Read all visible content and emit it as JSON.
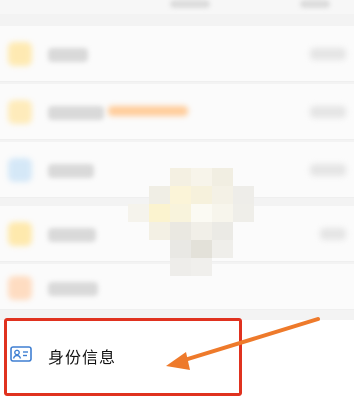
{
  "id_row": {
    "label": "身份信息",
    "icon": "id-card-icon"
  },
  "annotation": {
    "highlight_color": "#e0321f",
    "arrow_color": "#ee7a2b"
  }
}
